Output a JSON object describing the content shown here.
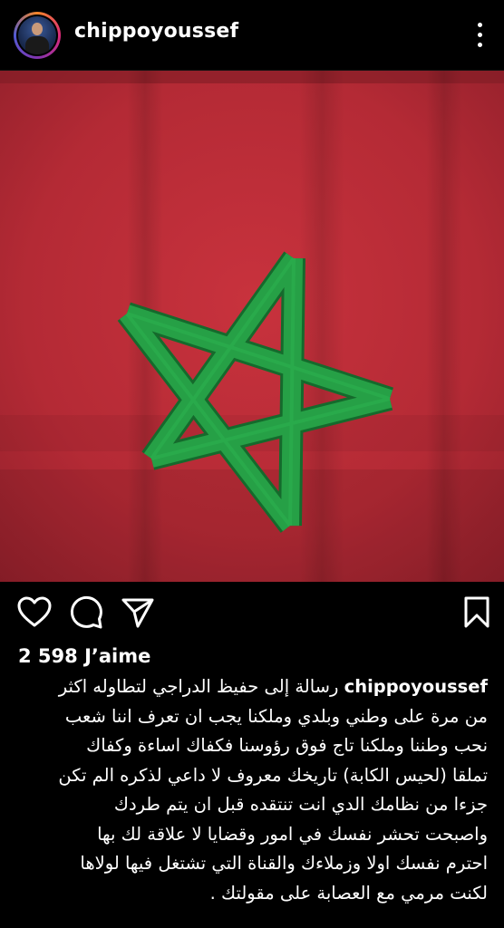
{
  "post": {
    "username": "chippoyoussef",
    "likes": "2 598 J’aime",
    "caption_first": "رسالة إلى حفيظ الدراجي لتطاوله اكثر",
    "caption_lines": [
      "من مرة على وطني وبلدي وملكنا يجب ان تعرف اننا شعب",
      "نحب وطننا وملكنا تاج فوق رؤوسنا فكفاك اساءة وكفاك",
      "تملقا (لحيس الكابة) تاريخك معروف لا داعي لذكره الم تكن",
      "جزءا من نظامك الدي انت تنتقده قبل ان يتم طردك",
      "واصبحت تحشر نفسك في امور وقضايا لا علاقة لك بها",
      "احترم نفسك اولا وزملاءك والقناة التي تشتغل فيها لولاها",
      "لكنت مرمي مع العصابة على مقولتك ."
    ]
  },
  "icons": {
    "more": "more-vertical-icon",
    "like": "heart-icon",
    "comment": "comment-icon",
    "share": "paper-plane-icon",
    "save": "bookmark-icon"
  },
  "colors": {
    "background": "#000000",
    "flag_red": "#b42a35",
    "star_green": "#1f8a3c",
    "text": "#ffffff"
  }
}
